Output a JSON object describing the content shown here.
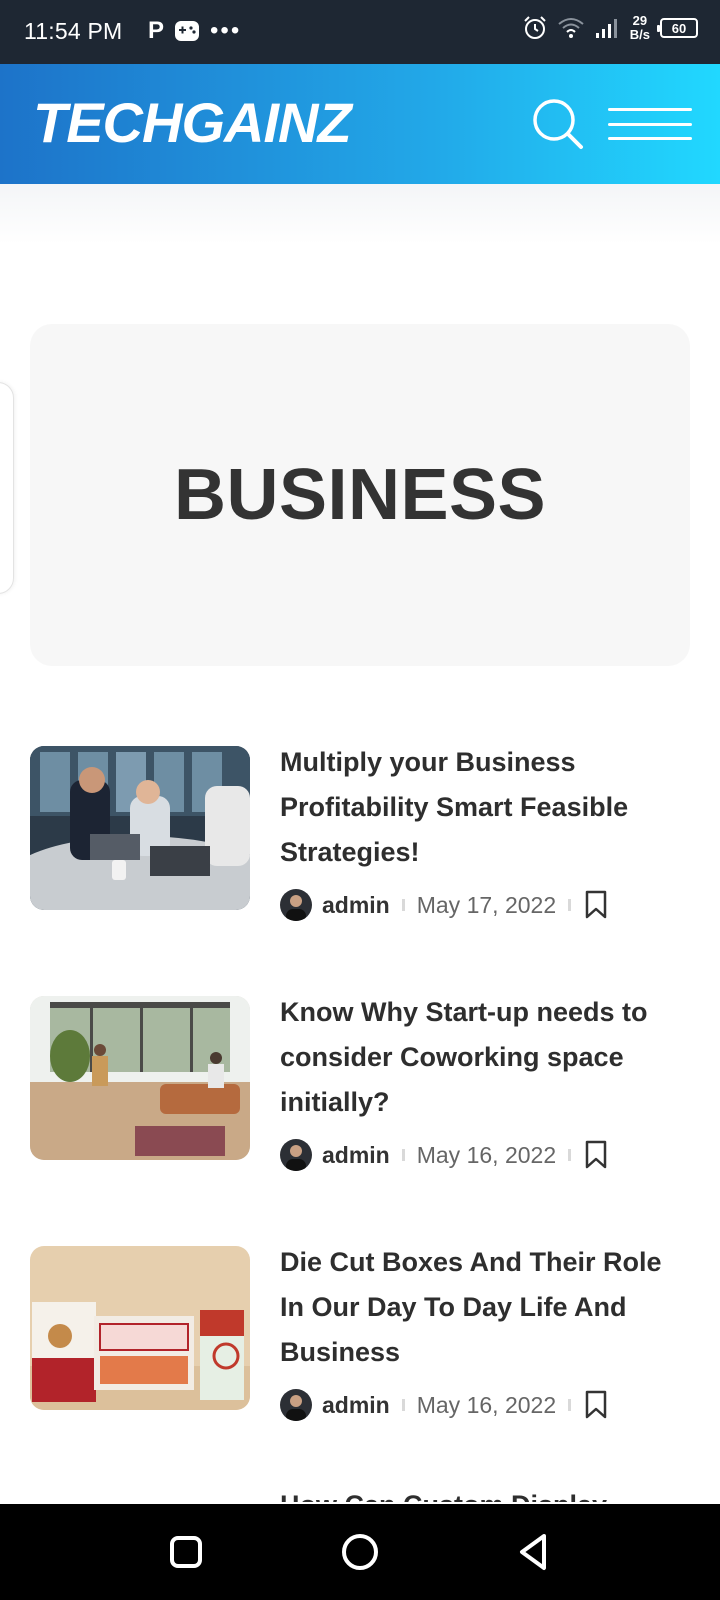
{
  "status_bar": {
    "time": "11:54 PM",
    "left_icons": [
      "p-icon",
      "game-controller-icon",
      "more-dots-icon"
    ],
    "p_label": "P",
    "dots": "•••",
    "speed_value": "29",
    "speed_unit": "B/s",
    "right_icons": [
      "alarm-icon",
      "wifi-icon",
      "signal-icon",
      "battery-icon"
    ],
    "battery": "60"
  },
  "header": {
    "logo": "TECHGAINZ",
    "gradient_colors": [
      "#1d73c9",
      "#21d8ff"
    ],
    "icons": [
      "search-icon",
      "hamburger-menu-icon"
    ]
  },
  "category": {
    "title": "BUSINESS"
  },
  "posts": [
    {
      "title": "Multiply your Business Profitability Smart Feasible Strategies!",
      "author": "admin",
      "date": "May 17, 2022",
      "thumbnail": "office meeting photo"
    },
    {
      "title": "Know Why Start-up needs to consider Coworking space initially?",
      "author": "admin",
      "date": "May 16, 2022",
      "thumbnail": "coworking space photo"
    },
    {
      "title": "Die Cut Boxes And Their Role In Our Day To Day Life And Business",
      "author": "admin",
      "date": "May 16, 2022",
      "thumbnail": "product boxes photo"
    }
  ],
  "partial_post_title": "How Can Custom Display",
  "nav_bar": {
    "icons": [
      "recent-apps-icon",
      "home-icon",
      "back-icon"
    ]
  }
}
